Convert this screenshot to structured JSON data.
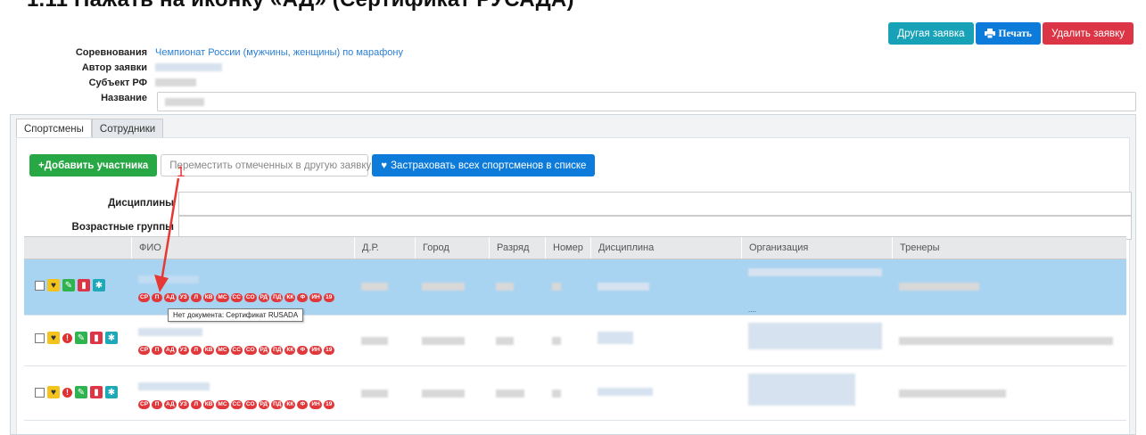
{
  "heading": "1.11 Нажать на иконку «АД» (Сертификат РУСАДА)",
  "topbar": {
    "other_request": "Другая заявка",
    "print": "Печать",
    "delete_request": "Удалить заявку"
  },
  "info": {
    "competition_label": "Соревнования",
    "competition_value": "Чемпионат России (мужчины, женщины) по марафону",
    "author_label": "Автор заявки",
    "subject_label": "Субъект РФ",
    "name_label": "Название"
  },
  "tabs": [
    "Спортсмены",
    "Сотрудники"
  ],
  "actions": {
    "add_participant": "+Добавить участника",
    "move_selected": "Переместить отмеченных в другую заявку",
    "insure_all": "Застраховать всех спортсменов в списке"
  },
  "filters": {
    "disciplines_label": "Дисциплины",
    "age_groups_label": "Возрастные группы"
  },
  "table": {
    "columns": [
      "ФИО",
      "Д.Р.",
      "Город",
      "Разряд",
      "Номер",
      "Дисциплина",
      "Организация",
      "Тренеры"
    ],
    "doc_badges": [
      "СР",
      "П",
      "АД",
      "УЗ",
      "Л",
      "КВ",
      "МС",
      "СС",
      "СО",
      "РД",
      "ПД",
      "КК",
      "Ф",
      "ИН",
      "19"
    ],
    "org_note": "...."
  },
  "tooltip": "Нет документа: Сертификат RUSADA",
  "annotation": {
    "step_number": "1"
  },
  "colors": {
    "accent": "#0d7bd9",
    "selected_row": "#a8d4f2",
    "badge": "#e0383b",
    "arrow": "#e53935"
  }
}
